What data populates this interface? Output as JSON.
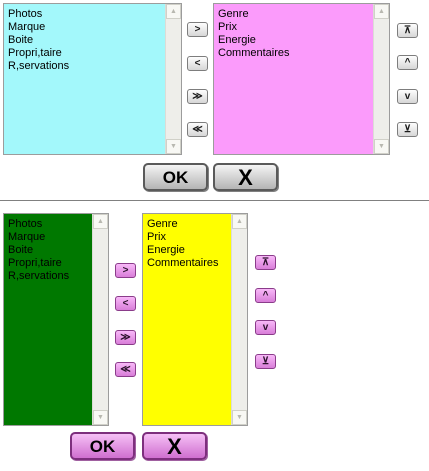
{
  "colors": {
    "top_source_bg": "#a3f8fb",
    "top_target_bg": "#fb9bfb",
    "bottom_source_bg": "#007800",
    "bottom_target_bg": "#ffff00"
  },
  "top_panel": {
    "source_list": [
      "Photos",
      "Marque",
      "Boite",
      "Propri,taire",
      "R,servations"
    ],
    "target_list": [
      "Genre",
      "Prix",
      "Energie",
      "Commentaires"
    ],
    "transfer_buttons": {
      "move_right": ">",
      "move_left": "<",
      "move_all_right": "≫",
      "move_all_left": "≪"
    },
    "order_buttons": {
      "move_top": "⊼",
      "move_up": "^",
      "move_down": "v",
      "move_bottom": "⊻"
    },
    "ok_label": "OK",
    "cancel_label": "X"
  },
  "bottom_panel": {
    "source_list": [
      "Photos",
      "Marque",
      "Boite",
      "Propri,taire",
      "R,servations"
    ],
    "target_list": [
      "Genre",
      "Prix",
      "Energie",
      "Commentaires"
    ],
    "transfer_buttons": {
      "move_right": ">",
      "move_left": "<",
      "move_all_right": "≫",
      "move_all_left": "≪"
    },
    "order_buttons": {
      "move_top": "⊼",
      "move_up": "^",
      "move_down": "v",
      "move_bottom": "⊻"
    },
    "ok_label": "OK",
    "cancel_label": "X"
  },
  "scroll_icons": {
    "up": "▲",
    "down": "▼"
  }
}
